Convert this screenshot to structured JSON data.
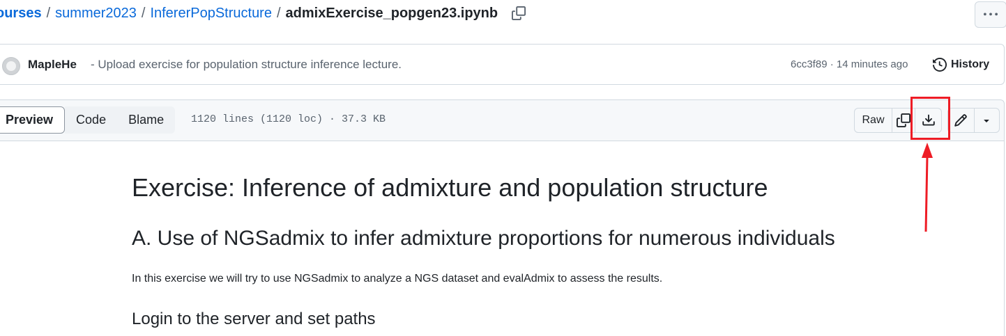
{
  "breadcrumb": {
    "items": [
      "ourses",
      "summer2023",
      "InfererPopStructure"
    ],
    "separator": "/",
    "current": "admixExercise_popgen23.ipynb"
  },
  "commit": {
    "author": "MapleHe",
    "message": "- Upload exercise for population structure inference lecture.",
    "meta": "6cc3f89 · 14 minutes ago",
    "history_label": "History"
  },
  "file_header": {
    "tabs": [
      "Preview",
      "Code",
      "Blame"
    ],
    "active_tab": "Preview",
    "info": "1120 lines (1120 loc) · 37.3 KB",
    "raw_label": "Raw"
  },
  "content": {
    "h1": "Exercise: Inference of admixture and population structure",
    "h2": "A. Use of NGSadmix to infer admixture proportions for numerous individuals",
    "paragraph": "In this exercise we will try to use NGSadmix to analyze a NGS dataset and evalAdmix to assess the results.",
    "h3": "Login to the server and set paths"
  },
  "colors": {
    "link": "#0969da",
    "annotation": "#ee1c25",
    "text": "#1f2328",
    "muted": "#59636e"
  }
}
